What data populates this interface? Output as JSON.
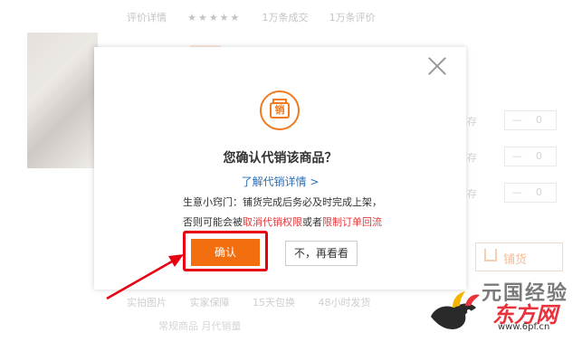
{
  "background": {
    "top_items": [
      "评价详情",
      "★★★★★",
      "1万条成交",
      "1万条评价"
    ],
    "rows": [
      {
        "label": "库存",
        "minus": "—",
        "value": "0"
      },
      {
        "label": "库存",
        "minus": "—",
        "value": "0"
      },
      {
        "label": "库存",
        "minus": "—",
        "value": "0"
      }
    ],
    "cart_label": "铺货",
    "footer_items": [
      "实拍图片",
      "实家保障",
      "15天包换",
      "48小时发货"
    ],
    "footer2": "常规商品  月代销量"
  },
  "dialog": {
    "badge_glyph": "销",
    "title": "您确认代销该商品？",
    "learn_more": "了解代销详情 >",
    "tip_line1": "生意小窍门：铺货完成后务必及时完成上架，",
    "tip_line2_prefix": "否则可能会被",
    "tip_line2_red1": "取消代销权限",
    "tip_line2_mid": "或者",
    "tip_line2_red2": "限制订单回流",
    "confirm_button": "确认",
    "cancel_button": "不，再看看"
  },
  "watermark_logo": {
    "text1": "元国经验",
    "text2": "东方网",
    "url": "www.6pf.cn"
  },
  "colors": {
    "accent": "#f26e0f",
    "highlight_red": "#e60012",
    "link_blue": "#2b6fb6",
    "warning_red": "#e4393c"
  }
}
